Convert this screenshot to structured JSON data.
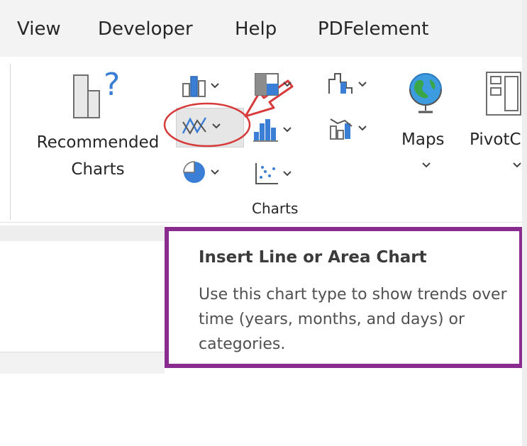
{
  "menu": {
    "items": [
      {
        "label": "View"
      },
      {
        "label": "Developer"
      },
      {
        "label": "Help"
      },
      {
        "label": "PDFelement"
      }
    ]
  },
  "ribbon": {
    "recommended_charts": {
      "line1": "Recommended",
      "line2": "Charts"
    },
    "group_label": "Charts",
    "maps_label": "Maps",
    "pivot_label": "PivotC"
  },
  "tooltip": {
    "title": "Insert Line or Area Chart",
    "body": "Use this chart type to show trends over time (years, months, and days) or categories."
  },
  "colors": {
    "annotation_red": "#d63a3a",
    "tooltip_border": "#8a2b8f",
    "icon_blue": "#3a7fd5",
    "icon_gray": "#6e6e6e"
  }
}
